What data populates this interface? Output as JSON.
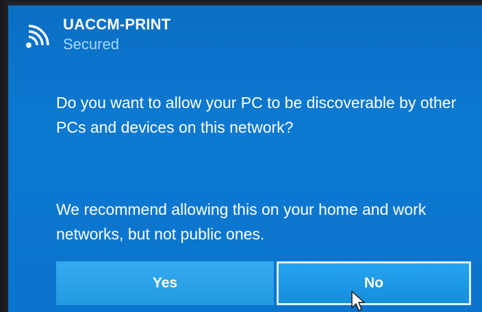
{
  "network": {
    "name": "UACCM-PRINT",
    "status": "Secured",
    "icon": "wifi-signal-icon"
  },
  "dialog": {
    "question": "Do you want to allow your PC to be discoverable by other PCs and devices on this network?",
    "recommendation": "We recommend allowing this on your home and work networks, but not public ones."
  },
  "buttons": {
    "yes_label": "Yes",
    "no_label": "No"
  },
  "colors": {
    "panel_background": "#0c77d0",
    "status_text": "#a7d9ff",
    "yes_button": "#2aa3e8",
    "no_button": "#1a9ae6",
    "no_button_focus_border": "#dff1ff"
  }
}
